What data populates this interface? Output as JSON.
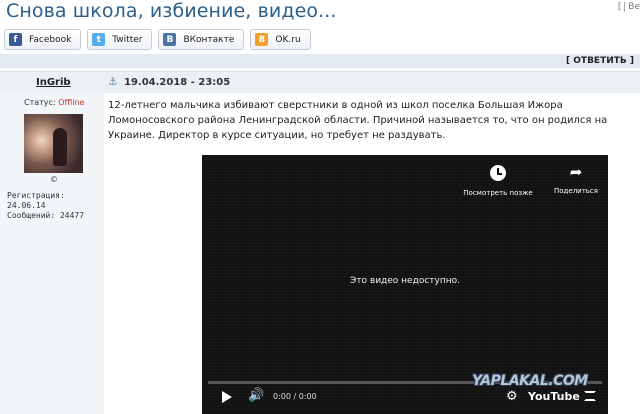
{
  "topic": {
    "title": "Снова школа, избиение, видео..."
  },
  "top_right": {
    "label_1": "[",
    "label_2": "Ве"
  },
  "share": [
    {
      "label": "Facebook",
      "icon": "facebook-icon",
      "color": "#3b5998",
      "glyph": "f"
    },
    {
      "label": "Twitter",
      "icon": "twitter-icon",
      "color": "#55acee",
      "glyph": "t"
    },
    {
      "label": "ВКонтакте",
      "icon": "vk-icon",
      "color": "#4c75a3",
      "glyph": "B"
    },
    {
      "label": "OK.ru",
      "icon": "ok-icon",
      "color": "#f2a233",
      "glyph": "8"
    }
  ],
  "reply": {
    "label": "[ ОТВЕТИТЬ ]"
  },
  "post": {
    "author": "InGrib",
    "date": "19.04.2018 - 23:05",
    "status_label": "Статус:",
    "status_value": "Offline",
    "copyright": "©",
    "registration": "Регистрация: 24.06.14",
    "messages": "Сообщений: 24477",
    "body": "12-летнего мальчика избивают сверстники в одной из школ поселка Большая Ижора Ломоносовского района Ленинградской области. Причиной называется то, что он родился на Украине. Директор в курсе ситуации, но требует не раздувать."
  },
  "video": {
    "watch_later": "Посмотреть позже",
    "share": "Поделиться",
    "unavailable": "Это видео недоступно.",
    "time": "0:00 / 0:00",
    "brand": "YouTube"
  },
  "watermark": "YAPLAKAL.COM",
  "colors": {
    "accent": "#2a5f8c",
    "offline": "#c0392b",
    "reply_bar": "#e4eaf1"
  }
}
